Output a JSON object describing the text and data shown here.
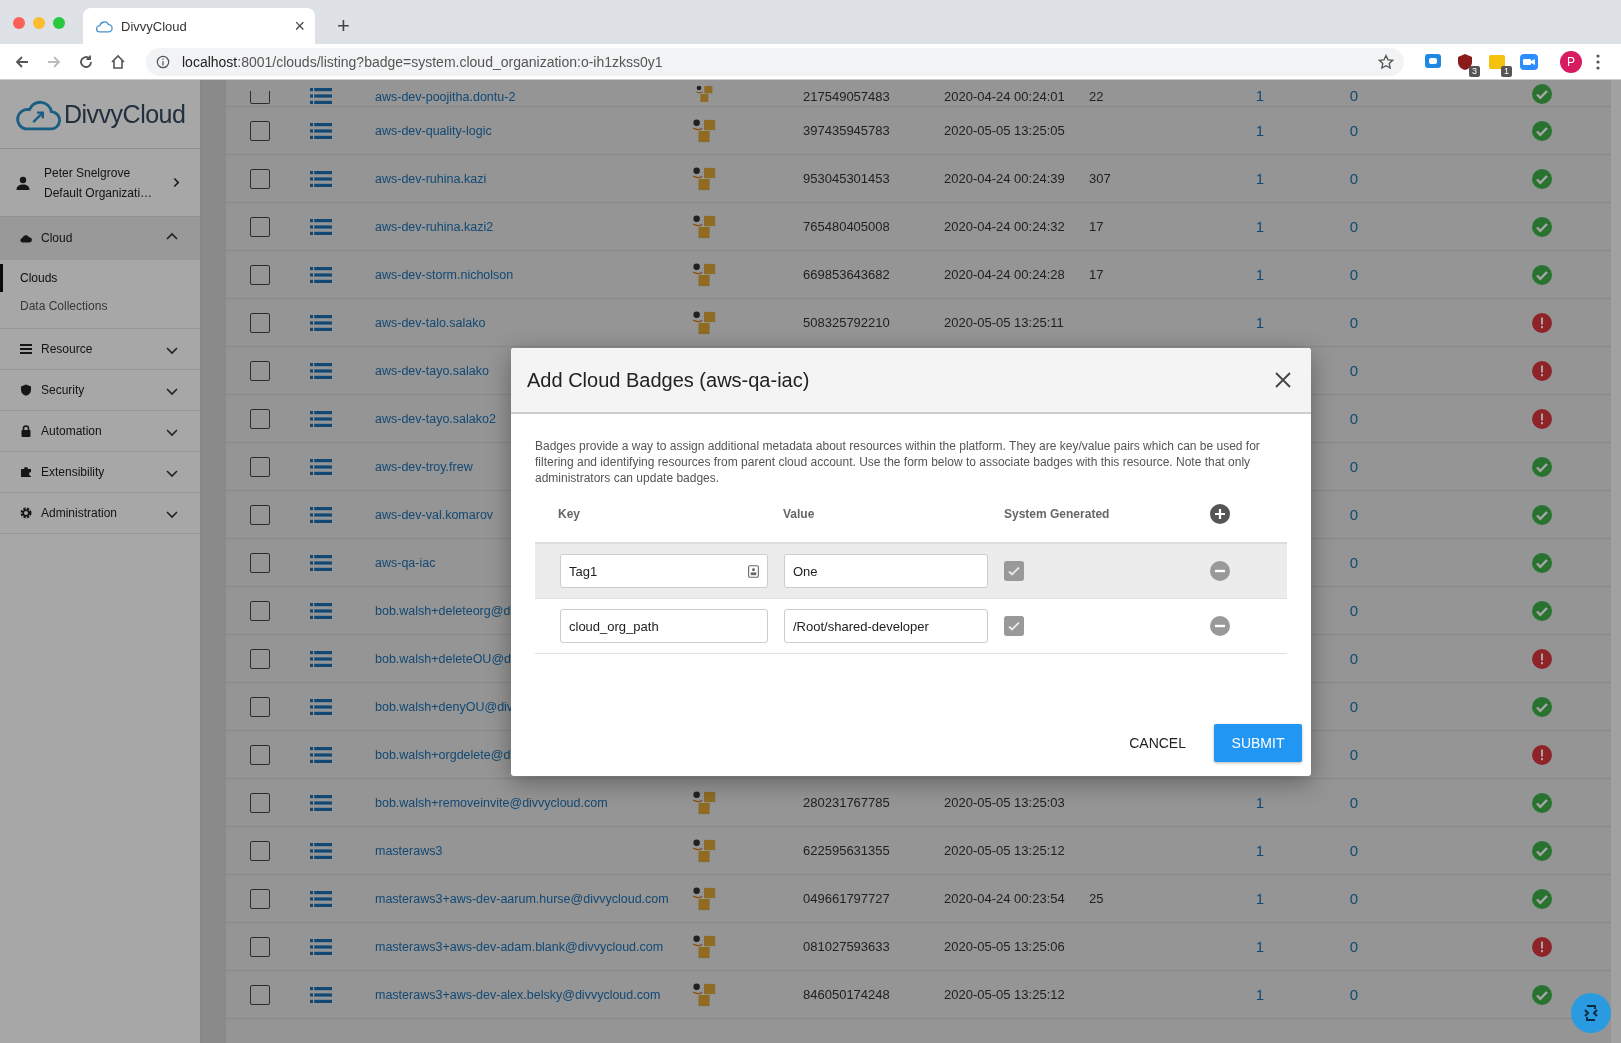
{
  "browser": {
    "tab_title": "DivvyCloud",
    "tab_close": "×",
    "new_tab": "+",
    "url_host": "localhost",
    "url_path": ":8001/clouds/listing?badge=system.cloud_organization:o-ih1zkss0y1",
    "extensions": [
      {
        "kind": "chat"
      },
      {
        "kind": "shield",
        "badge": "3"
      },
      {
        "kind": "note",
        "badge": "1"
      },
      {
        "kind": "video"
      }
    ],
    "profile": "P"
  },
  "sidebar": {
    "logo": "DivvyCloud",
    "user": {
      "name": "Peter Snelgrove",
      "org": "Default Organizati…"
    },
    "sections": [
      {
        "label": "Cloud",
        "expanded": true,
        "children": [
          {
            "label": "Clouds",
            "selected": true
          },
          {
            "label": "Data Collections",
            "selected": false
          }
        ]
      },
      {
        "label": "Resource",
        "expanded": false
      },
      {
        "label": "Security",
        "expanded": false
      },
      {
        "label": "Automation",
        "expanded": false
      },
      {
        "label": "Extensibility",
        "expanded": false
      },
      {
        "label": "Administration",
        "expanded": false
      }
    ]
  },
  "table": {
    "rows": [
      {
        "name": "aws-dev-poojitha.dontu-2",
        "account": "217549057483",
        "created": "2020-04-24 00:24:01",
        "resources": "22",
        "col_1": "1",
        "col_2": "0",
        "healthy": true,
        "checked": false
      },
      {
        "name": "aws-dev-quality-logic",
        "account": "397435945783",
        "created": "2020-05-05 13:25:05",
        "col_1": "1",
        "col_2": "0",
        "healthy": true,
        "checked": false
      },
      {
        "name": "aws-dev-ruhina.kazi",
        "account": "953045301453",
        "created": "2020-04-24 00:24:39",
        "resources": "307",
        "col_1": "1",
        "col_2": "0",
        "healthy": true,
        "checked": false
      },
      {
        "name": "aws-dev-ruhina.kazi2",
        "account": "765480405008",
        "created": "2020-04-24 00:24:32",
        "resources": "17",
        "col_1": "1",
        "col_2": "0",
        "healthy": true,
        "checked": false
      },
      {
        "name": "aws-dev-storm.nicholson",
        "account": "669853643682",
        "created": "2020-04-24 00:24:28",
        "resources": "17",
        "col_1": "1",
        "col_2": "0",
        "healthy": true,
        "checked": false
      },
      {
        "name": "aws-dev-talo.salako",
        "account": "508325792210",
        "created": "2020-05-05 13:25:11",
        "col_1": "1",
        "col_2": "0",
        "healthy": false,
        "checked": false
      },
      {
        "name": "aws-dev-tayo.salako",
        "col_2": "0",
        "healthy": false,
        "checked": false
      },
      {
        "name": "aws-dev-tayo.salako2",
        "col_2": "0",
        "healthy": false,
        "checked": false
      },
      {
        "name": "aws-dev-troy.frew",
        "col_2": "0",
        "healthy": true,
        "checked": false
      },
      {
        "name": "aws-dev-val.komarov",
        "col_2": "0",
        "healthy": true,
        "checked": false
      },
      {
        "name": "aws-qa-iac",
        "col_2": "0",
        "healthy": true,
        "checked": false
      },
      {
        "name": "bob.walsh+deleteorg@d",
        "col_2": "0",
        "healthy": true,
        "checked": false
      },
      {
        "name": "bob.walsh+deleteOU@d",
        "col_2": "0",
        "healthy": false,
        "checked": false
      },
      {
        "name": "bob.walsh+denyOU@div",
        "col_2": "0",
        "healthy": true,
        "checked": false
      },
      {
        "name": "bob.walsh+orgdelete@d",
        "col_2": "0",
        "healthy": false,
        "checked": false
      },
      {
        "name": "bob.walsh+removeinvite@divvycloud.com",
        "account": "280231767785",
        "created": "2020-05-05 13:25:03",
        "col_1": "1",
        "col_2": "0",
        "healthy": true,
        "checked": false
      },
      {
        "name": "masteraws3",
        "account": "622595631355",
        "created": "2020-05-05 13:25:12",
        "col_1": "1",
        "col_2": "0",
        "healthy": true,
        "checked": false
      },
      {
        "name": "masteraws3+aws-dev-aarum.hurse@divvycloud.com",
        "account": "049661797727",
        "created": "2020-04-24 00:23:54",
        "resources": "25",
        "col_1": "1",
        "col_2": "0",
        "healthy": true,
        "checked": false
      },
      {
        "name": "masteraws3+aws-dev-adam.blank@divvycloud.com",
        "account": "081027593633",
        "created": "2020-05-05 13:25:06",
        "col_1": "1",
        "col_2": "0",
        "healthy": false,
        "checked": false
      },
      {
        "name": "masteraws3+aws-dev-alex.belsky@divvycloud.com",
        "account": "846050174248",
        "created": "2020-05-05 13:25:12",
        "col_1": "1",
        "col_2": "0",
        "healthy": true,
        "checked": false
      }
    ]
  },
  "modal": {
    "title": "Add Cloud Badges (aws-qa-iac)",
    "description": "Badges provide a way to assign additional metadata about resources within the platform. They are key/value pairs which can be used for filtering and identifying resources from parent cloud account. Use the form below to associate badges with this resource. Note that only administrators can update badges.",
    "columns": [
      "Key",
      "Value",
      "System Generated"
    ],
    "rows": [
      {
        "key": "Tag1",
        "value": "One",
        "system_generated": true,
        "hovered": true,
        "autofill": true
      },
      {
        "key": "cloud_org_path",
        "value": "/Root/shared-developer",
        "system_generated": true,
        "hovered": false,
        "autofill": false
      }
    ],
    "buttons": [
      "CANCEL",
      "SUBMIT"
    ]
  }
}
